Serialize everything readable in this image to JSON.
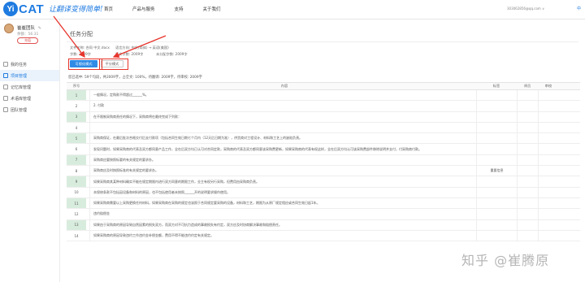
{
  "header": {
    "logo_mark": "Yi",
    "logo_text": "CAT",
    "slogan": "让翻译变得简单!",
    "nav": [
      "首页",
      "产品与服务",
      "支持",
      "关于我们"
    ],
    "user_email": "303062856@qq.com",
    "user_caret": "∨",
    "lang": "中"
  },
  "sidebar": {
    "team_name": "崔崔团队",
    "balance": "余额：56.31",
    "recharge": "充值",
    "items": [
      {
        "label": "我的任务",
        "active": false
      },
      {
        "label": "项目管理",
        "active": true
      },
      {
        "label": "记忆库管理",
        "active": false
      },
      {
        "label": "术语库管理",
        "active": false
      },
      {
        "label": "团队管理",
        "active": false
      }
    ]
  },
  "main": {
    "title": "任务分配",
    "meta": {
      "file": "文件名称: 合同 中文.docx",
      "lang": "语言方向: 中文(简体) → 英语(美国)",
      "total": "字数: 2009字",
      "src_total": "原文字数: 2009字",
      "unassigned": "未分配字数: 2009字"
    },
    "mode_smart": "可视化模式",
    "mode_avg": "平分模式",
    "summary": "您已选中: 59个句段，共2009字，占全文: 100%，待翻译: 2009字，待审校: 2009字",
    "table": {
      "headers": {
        "no": "序号",
        "content": "内容",
        "tag": "标签",
        "s1": "译员",
        "s2": "审校"
      },
      "rows": [
        {
          "no": "1",
          "text": "一般情况，定购款不得超过______%。",
          "tag": ""
        },
        {
          "no": "2",
          "text": "2. 付款",
          "tag": ""
        },
        {
          "no": "3",
          "text": "在不限制采购商责任的情况下，采购商将在最终完成下列款：",
          "tag": ""
        },
        {
          "no": "4",
          "text": "",
          "tag": ""
        },
        {
          "no": "5",
          "text": "采购商保证，在最后批次合格交付后支付款项（包括合同生效日期七个月内（12天后日期为准），供货商对工程设计、材料和工艺上的缺陷负责。",
          "tag": ""
        },
        {
          "no": "6",
          "text": "发现问题时，如果采购商的代表及双方都同意产品工作，全在后双方均已认可对合同定款，采购商的代表及双方都同意该采购费更新，如果采购商的代表有权这样，全在后双方均认可该采购费部件移除说明并支付，付采购商付款。",
          "tag": ""
        },
        {
          "no": "7",
          "text": "采购商应要按照标要的有关规定的要求办。",
          "tag": ""
        },
        {
          "no": "8",
          "text": "采购商应及时按照标准的有关规定的要求办。",
          "tag": "重要信息"
        },
        {
          "no": "9",
          "text": "如果采购商其某种材料确实不能在规定期限内进行双方同意的期限工作，业主有权另行采购，但费用由采购商负责。",
          "tag": ""
        },
        {
          "no": "10",
          "text": "本保修条款不包括因设备和材料的原因，也不包括使用者未按照______开的说明要求操作使用。",
          "tag": ""
        },
        {
          "no": "11",
          "text": "如果采购商需要以上采购更换任何材料，如果采购商在采购的规定也该照于合同规定要采购的设备，材料和工艺，期限为从原厂规定相应或合同生效日起1年。",
          "tag": ""
        },
        {
          "no": "12",
          "text": "违约赔偿金",
          "tag": ""
        },
        {
          "no": "13",
          "text": "如果由于采购商的原因导致自然因素的损失双方，而双方对不可抗力造成的事故损失有约定，双方应及时协商解决事故和赔偿责任。",
          "tag": ""
        },
        {
          "no": "14",
          "text": "如果采购商的原因导致违约工作违约金补偿金额，费用不得不能违约约定有关规定。",
          "tag": ""
        }
      ]
    }
  },
  "watermark": "知乎 @崔腾原",
  "colors": {
    "accent": "#1f7be0",
    "annotation": "#e8342b",
    "row_green": "#d8ecdd"
  },
  "icons": {
    "edit": "✎"
  }
}
